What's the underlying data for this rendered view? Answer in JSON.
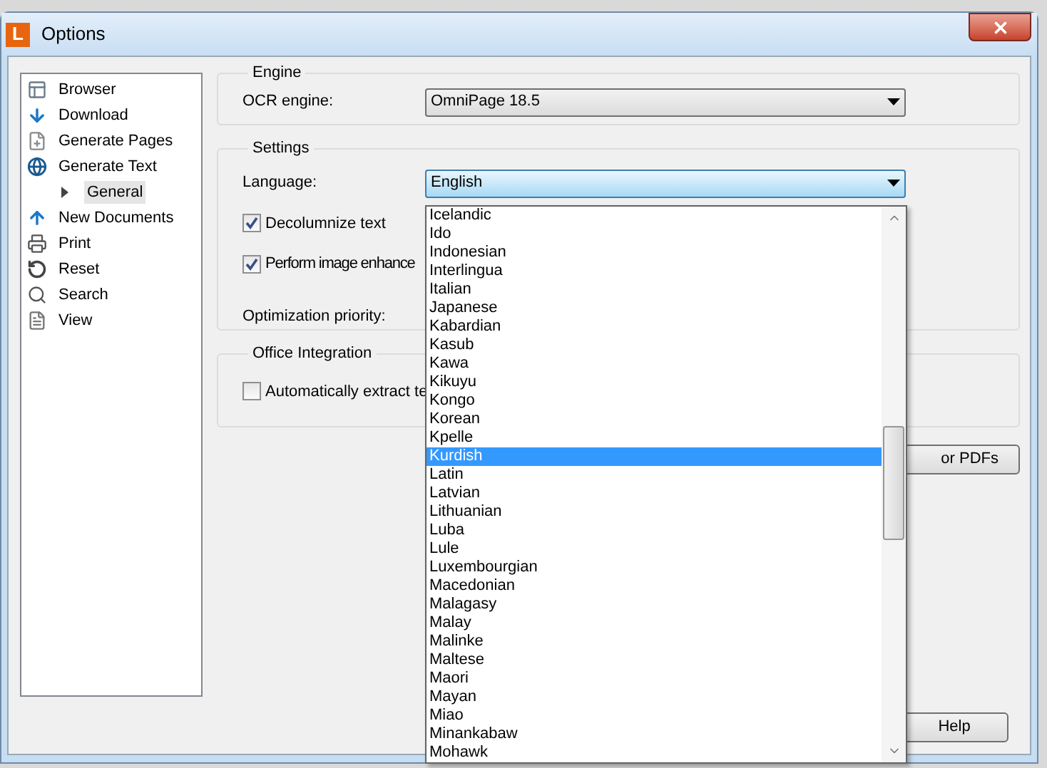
{
  "window": {
    "title": "Options",
    "app_icon": "L"
  },
  "sidebar": {
    "items": [
      {
        "label": "Browser",
        "selected": false
      },
      {
        "label": "Download",
        "selected": false
      },
      {
        "label": "Generate Pages",
        "selected": false
      },
      {
        "label": "Generate Text",
        "selected": false,
        "children": [
          {
            "label": "General",
            "selected": true
          }
        ]
      },
      {
        "label": "New Documents",
        "selected": false
      },
      {
        "label": "Print",
        "selected": false
      },
      {
        "label": "Reset",
        "selected": false
      },
      {
        "label": "Search",
        "selected": false
      },
      {
        "label": "View",
        "selected": false
      }
    ]
  },
  "engine": {
    "title": "Engine",
    "ocr_engine": {
      "label": "OCR engine:",
      "value": "OmniPage 18.5"
    }
  },
  "settings": {
    "title": "Settings",
    "language": {
      "label": "Language:",
      "value": "English",
      "expanded": true,
      "options": [
        {
          "label": "Icelandic",
          "selected": false
        },
        {
          "label": "Ido",
          "selected": false
        },
        {
          "label": "Indonesian",
          "selected": false
        },
        {
          "label": "Interlingua",
          "selected": false
        },
        {
          "label": "Italian",
          "selected": false
        },
        {
          "label": "Japanese",
          "selected": false
        },
        {
          "label": "Kabardian",
          "selected": false
        },
        {
          "label": "Kasub",
          "selected": false
        },
        {
          "label": "Kawa",
          "selected": false
        },
        {
          "label": "Kikuyu",
          "selected": false
        },
        {
          "label": "Kongo",
          "selected": false
        },
        {
          "label": "Korean",
          "selected": false
        },
        {
          "label": "Kpelle",
          "selected": false
        },
        {
          "label": "Kurdish",
          "selected": true
        },
        {
          "label": "Latin",
          "selected": false
        },
        {
          "label": "Latvian",
          "selected": false
        },
        {
          "label": "Lithuanian",
          "selected": false
        },
        {
          "label": "Luba",
          "selected": false
        },
        {
          "label": "Lule",
          "selected": false
        },
        {
          "label": "Luxembourgian",
          "selected": false
        },
        {
          "label": "Macedonian",
          "selected": false
        },
        {
          "label": "Malagasy",
          "selected": false
        },
        {
          "label": "Malay",
          "selected": false
        },
        {
          "label": "Malinke",
          "selected": false
        },
        {
          "label": "Maltese",
          "selected": false
        },
        {
          "label": "Maori",
          "selected": false
        },
        {
          "label": "Mayan",
          "selected": false
        },
        {
          "label": "Miao",
          "selected": false
        },
        {
          "label": "Minankabaw",
          "selected": false
        },
        {
          "label": "Mohawk",
          "selected": false
        }
      ]
    },
    "decolumnize": {
      "label": "Decolumnize text",
      "checked": true
    },
    "image_enhance": {
      "label": "Perform image enhance",
      "checked": true
    },
    "optimization": {
      "label": "Optimization priority:"
    }
  },
  "office_integration": {
    "title": "Office Integration",
    "auto_extract": {
      "label": "Automatically extract te",
      "checked": false
    }
  },
  "buttons": [
    {
      "label": "or PDFs"
    },
    {
      "label": "Help"
    }
  ]
}
